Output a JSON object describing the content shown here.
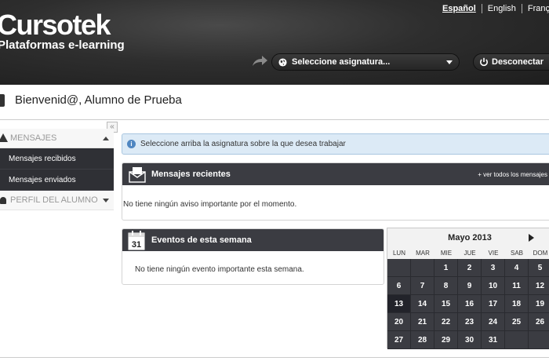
{
  "header": {
    "logo_title": "Cursotek",
    "logo_subtitle": "Plataformas e-learning",
    "languages": [
      "Español",
      "English",
      "Français"
    ],
    "subject_select": "Seleccione asignatura...",
    "logout_label": "Desconectar"
  },
  "welcome": {
    "text": "Bienvenid@, Alumno de Prueba"
  },
  "sidebar": {
    "collapse_label": "«",
    "sections": [
      {
        "label": "MENSAJES",
        "expanded": true,
        "items": [
          "Mensajes recibidos",
          "Mensajes enviados"
        ]
      },
      {
        "label": "PERFIL DEL ALUMNO",
        "expanded": false,
        "items": []
      }
    ]
  },
  "main": {
    "info_text": "Seleccione arriba la asignatura sobre la que desea trabajar",
    "recent_messages": {
      "title": "Mensajes recientes",
      "link": "+ ver todos los mensajes",
      "empty_text": "No tiene ningún aviso importante por el momento."
    },
    "weekly_events": {
      "title": "Eventos de esta semana",
      "icon_day": "31",
      "empty_text": "No tiene ningún evento importante esta semana."
    }
  },
  "calendar": {
    "month": "Mayo 2013",
    "weekdays": [
      "LUN",
      "MAR",
      "MIE",
      "JUE",
      "VIE",
      "SAB",
      "DOM"
    ],
    "today": "13",
    "weeks": [
      [
        "",
        "",
        "1",
        "2",
        "3",
        "4",
        "5"
      ],
      [
        "6",
        "7",
        "8",
        "9",
        "10",
        "11",
        "12"
      ],
      [
        "13",
        "14",
        "15",
        "16",
        "17",
        "18",
        "19"
      ],
      [
        "20",
        "21",
        "22",
        "23",
        "24",
        "25",
        "26"
      ],
      [
        "27",
        "28",
        "29",
        "30",
        "31",
        "",
        ""
      ]
    ]
  },
  "colors": {
    "dark_panel": "#3b3c42",
    "info_bg": "#dceaf6",
    "info_accent": "#4f86c1"
  }
}
